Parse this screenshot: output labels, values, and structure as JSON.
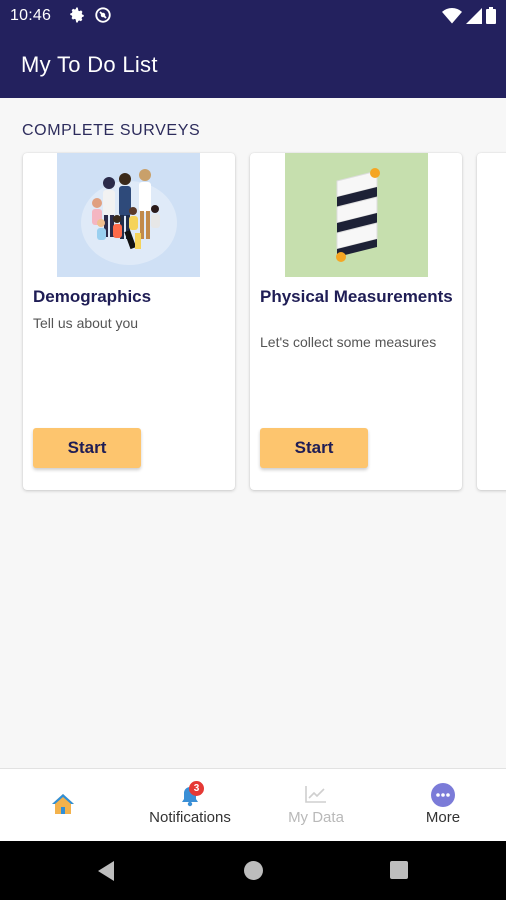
{
  "status_bar": {
    "time": "10:46"
  },
  "app_bar": {
    "title": "My To Do List"
  },
  "section": {
    "title": "COMPLETE SURVEYS"
  },
  "cards": [
    {
      "title": "Demographics",
      "description": "Tell us about you",
      "button": "Start",
      "image_bg": "#cfe0f5"
    },
    {
      "title": "Physical Measurements",
      "description": "Let's collect some measures",
      "button": "Start",
      "image_bg": "#c6dfae"
    }
  ],
  "bottom_nav": {
    "home": {
      "icon": "home-icon",
      "color": "#2f8fd8"
    },
    "notifications": {
      "label": "Notifications",
      "badge": "3"
    },
    "my_data": {
      "label": "My Data"
    },
    "more": {
      "label": "More",
      "color": "#7b7bd8"
    }
  },
  "colors": {
    "primary": "#23215e",
    "button": "#fdc56e",
    "badge": "#e53935"
  }
}
